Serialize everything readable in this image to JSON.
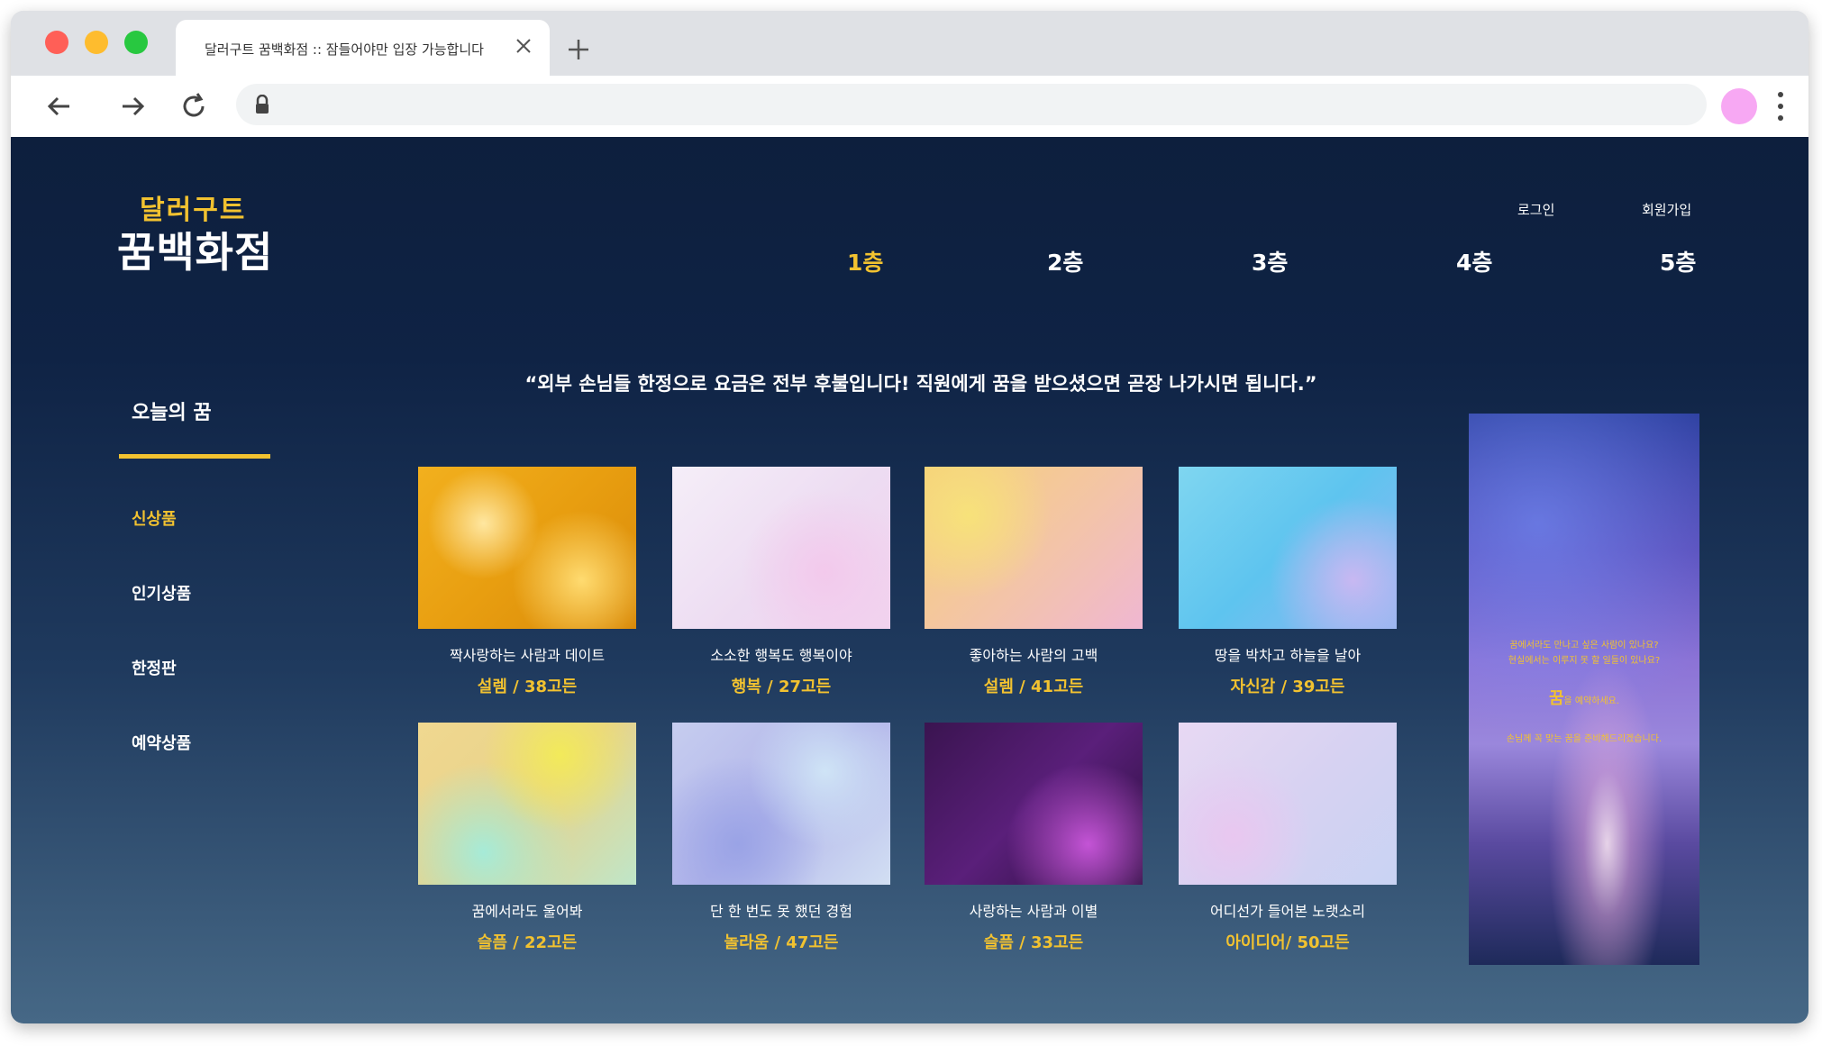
{
  "browser": {
    "tab_title": "달러구트 꿈백화점 :: 잠들어야만 입장 가능합니다"
  },
  "header": {
    "logo_top": "달러구트",
    "logo_main": "꿈백화점",
    "login": "로그인",
    "signup": "회원가입",
    "floors": [
      "1층",
      "2층",
      "3층",
      "4층",
      "5층"
    ]
  },
  "notice": "“외부 손님들 한정으로 요금은 전부 후불입니다! 직원에게 꿈을 받으셨으면 곧장 나가시면 됩니다.”",
  "sidebar": {
    "title": "오늘의 꿈",
    "items": [
      "신상품",
      "인기상품",
      "한정판",
      "예약상품"
    ]
  },
  "products": [
    {
      "title": "짝사랑하는 사람과 데이트",
      "price": "설렘 / 38고든"
    },
    {
      "title": "소소한 행복도 행복이야",
      "price": "행복 / 27고든"
    },
    {
      "title": "좋아하는 사람의 고백",
      "price": "설렘 / 41고든"
    },
    {
      "title": "땅을 박차고 하늘을 날아",
      "price": "자신감 / 39고든"
    },
    {
      "title": "꿈에서라도 울어봐",
      "price": "슬픔 / 22고든"
    },
    {
      "title": "단 한 번도 못 했던 경험",
      "price": "놀라움 / 47고든"
    },
    {
      "title": "사랑하는 사람과 이별",
      "price": "슬픔 / 33고든"
    },
    {
      "title": "어디선가 들어본 노랫소리",
      "price": "아이디어/ 50고든"
    }
  ],
  "banner": {
    "line1": "꿈에서라도 만나고 싶은 사람이 있나요?",
    "line2": "현실에서는 이루지 못 할 일들이 있나요?",
    "big": "꿈",
    "big_suffix": "을 예약하세요.",
    "line3": "손님께 꼭 맞는 꿈을 준비해드리겠습니다."
  },
  "colors": {
    "accent": "#f2c230",
    "page_top": "#0d1f3d",
    "page_bottom": "#466886"
  }
}
